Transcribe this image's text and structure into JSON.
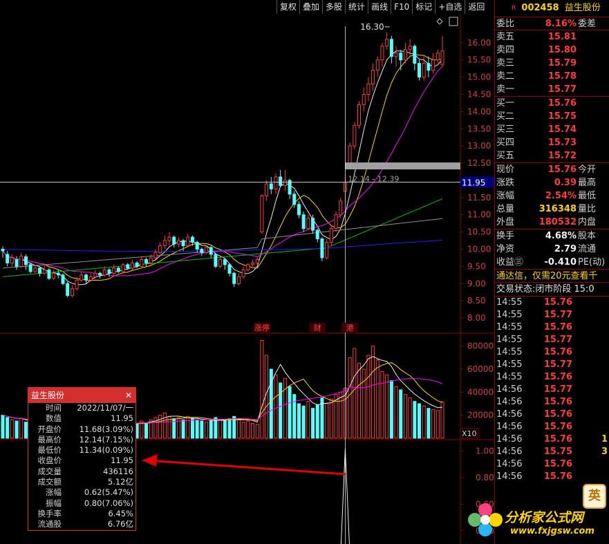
{
  "toolbar": [
    "复权",
    "叠加",
    "多股",
    "统计",
    "画线",
    "F10",
    "标记",
    "+自选",
    "返回"
  ],
  "stock": {
    "flag": "R",
    "code": "002458",
    "name": "益生股份"
  },
  "weibi": {
    "label": "委比",
    "value": "8.16%",
    "label2": "委差"
  },
  "sell": [
    {
      "label": "卖五",
      "price": "15.81"
    },
    {
      "label": "卖四",
      "price": "15.80"
    },
    {
      "label": "卖三",
      "price": "15.79"
    },
    {
      "label": "卖二",
      "price": "15.78"
    },
    {
      "label": "卖一",
      "price": "15.77"
    }
  ],
  "buy": [
    {
      "label": "买一",
      "price": "15.76"
    },
    {
      "label": "买二",
      "price": "15.75"
    },
    {
      "label": "买三",
      "price": "15.74"
    },
    {
      "label": "买四",
      "price": "15.73"
    },
    {
      "label": "买五",
      "price": "15.72"
    }
  ],
  "quote": [
    {
      "label": "现价",
      "value": "15.76",
      "label2": "今开",
      "color": "red"
    },
    {
      "label": "涨跌",
      "value": "0.39",
      "label2": "最高",
      "color": "red"
    },
    {
      "label": "涨幅",
      "value": "2.54%",
      "label2": "最低",
      "color": "red"
    },
    {
      "label": "总量",
      "value": "316348",
      "label2": "量比",
      "color": "yel"
    },
    {
      "label": "外盘",
      "value": "180532",
      "label2": "内盘",
      "color": "red"
    }
  ],
  "fund": [
    {
      "label": "换手",
      "value": "4.68%",
      "label2": "股本"
    },
    {
      "label": "净资",
      "value": "2.79",
      "label2": "流通"
    },
    {
      "label": "收益㊂",
      "value": "-0.410",
      "label2": "PE(动)"
    }
  ],
  "notice": "通达信，仅需20元查看千",
  "trade_state": "交易状态:闭市阶段 15:0",
  "ticks": [
    {
      "time": "14:55",
      "price": "15.76",
      "vol": ""
    },
    {
      "time": "14:55",
      "price": "15.77",
      "vol": ""
    },
    {
      "time": "14:55",
      "price": "15.76",
      "vol": ""
    },
    {
      "time": "14:55",
      "price": "15.77",
      "vol": ""
    },
    {
      "time": "14:55",
      "price": "15.76",
      "vol": ""
    },
    {
      "time": "14:55",
      "price": "15.77",
      "vol": ""
    },
    {
      "time": "14:55",
      "price": "15.76",
      "vol": ""
    },
    {
      "time": "14:56",
      "price": "15.77",
      "vol": ""
    },
    {
      "time": "14:56",
      "price": "15.76",
      "vol": ""
    },
    {
      "time": "14:56",
      "price": "15.76",
      "vol": ""
    },
    {
      "time": "14:56",
      "price": "15.76",
      "vol": ""
    },
    {
      "time": "14:56",
      "price": "15.76",
      "vol": "1"
    },
    {
      "time": "14:56",
      "price": "15.75",
      "vol": "3"
    },
    {
      "time": "14:56",
      "price": "15.76",
      "vol": ""
    },
    {
      "time": "14:56",
      "price": "15.76",
      "vol": ""
    }
  ],
  "info": {
    "title": "益生股份",
    "close_icon": "close-icon",
    "rows": [
      {
        "k": "时间",
        "v": "2022/11/07/一",
        "c": "wht"
      },
      {
        "k": "数值",
        "v": "11.95",
        "c": "wht"
      },
      {
        "k": "开盘价",
        "v": "11.68(3.09%)",
        "c": "red"
      },
      {
        "k": "最高价",
        "v": "12.14(7.15%)",
        "c": "red"
      },
      {
        "k": "最低价",
        "v": "11.34(0.09%)",
        "c": "red"
      },
      {
        "k": "收盘价",
        "v": "11.95",
        "c": "red"
      },
      {
        "k": "成交量",
        "v": "436116",
        "c": "yel"
      },
      {
        "k": "成交额",
        "v": "5.12亿",
        "c": "wht"
      },
      {
        "k": "涨幅",
        "v": "0.62(5.47%)",
        "c": "red"
      },
      {
        "k": "振幅",
        "v": "0.80(7.06%)",
        "c": "wht"
      },
      {
        "k": "换手率",
        "v": "6.45%",
        "c": "wht"
      },
      {
        "k": "流通股",
        "v": "6.76亿",
        "c": "wht"
      }
    ]
  },
  "chart_data": {
    "type": "candlestick",
    "price_axis": [
      "16.00",
      "15.50",
      "15.00",
      "14.50",
      "14.00",
      "13.50",
      "13.00",
      "12.50",
      "12.00",
      "11.50",
      "11.00",
      "10.50",
      "10.00",
      "9.50",
      "9.00",
      "8.50",
      "8.00"
    ],
    "price_range": [
      7.8,
      16.8
    ],
    "volume_axis": [
      "80000",
      "60000",
      "40000",
      "20000"
    ],
    "volume_unit": "X10",
    "volume_range": [
      0,
      90000
    ],
    "indicator_axis": [
      "1.00",
      "0.80",
      "0.60",
      "0.40"
    ],
    "indicator_range": [
      0.3,
      1.08
    ],
    "crosshair_value": "11.95",
    "high_label": "16.30",
    "gap_label": "12.14 - 12.39",
    "events": [
      {
        "text": "涨停",
        "index": 56
      },
      {
        "text": "财",
        "index": 68
      },
      {
        "text": "港",
        "index": 75
      }
    ],
    "selected_index": 74,
    "candles": [
      [
        10.0,
        9.95,
        10.08,
        9.75
      ],
      [
        9.85,
        9.6,
        9.95,
        9.5
      ],
      [
        9.6,
        9.75,
        9.85,
        9.5
      ],
      [
        9.7,
        9.5,
        9.8,
        9.4
      ],
      [
        9.5,
        9.8,
        9.9,
        9.45
      ],
      [
        9.78,
        9.55,
        9.85,
        9.4
      ],
      [
        9.55,
        9.35,
        9.6,
        9.3
      ],
      [
        9.35,
        9.45,
        9.55,
        9.3
      ],
      [
        9.45,
        9.3,
        9.5,
        9.2
      ],
      [
        9.3,
        9.4,
        9.55,
        9.25
      ],
      [
        9.4,
        9.15,
        9.45,
        9.1
      ],
      [
        9.15,
        9.3,
        9.4,
        9.1
      ],
      [
        9.3,
        9.25,
        9.4,
        9.15
      ],
      [
        9.25,
        9.0,
        9.3,
        8.95
      ],
      [
        9.0,
        8.65,
        9.05,
        8.6
      ],
      [
        8.65,
        8.85,
        8.95,
        8.6
      ],
      [
        8.85,
        9.1,
        9.2,
        8.8
      ],
      [
        9.1,
        9.25,
        9.35,
        9.05
      ],
      [
        9.25,
        9.1,
        9.3,
        9.0
      ],
      [
        9.1,
        9.2,
        9.3,
        9.05
      ],
      [
        9.2,
        9.3,
        9.4,
        9.15
      ],
      [
        9.3,
        9.25,
        9.35,
        9.15
      ],
      [
        9.25,
        9.4,
        9.5,
        9.2
      ],
      [
        9.4,
        9.3,
        9.45,
        9.2
      ],
      [
        9.3,
        9.45,
        9.55,
        9.25
      ],
      [
        9.45,
        9.35,
        9.5,
        9.3
      ],
      [
        9.35,
        9.55,
        9.6,
        9.3
      ],
      [
        9.55,
        9.45,
        9.6,
        9.4
      ],
      [
        9.45,
        9.6,
        9.7,
        9.4
      ],
      [
        9.6,
        9.5,
        9.65,
        9.45
      ],
      [
        9.5,
        9.7,
        9.8,
        9.45
      ],
      [
        9.7,
        9.6,
        9.75,
        9.5
      ],
      [
        9.6,
        9.75,
        9.85,
        9.55
      ],
      [
        9.75,
        9.9,
        10.0,
        9.7
      ],
      [
        9.9,
        10.1,
        10.2,
        9.85
      ],
      [
        10.1,
        10.25,
        10.4,
        10.0
      ],
      [
        10.25,
        10.35,
        10.5,
        10.1
      ],
      [
        10.35,
        10.15,
        10.4,
        10.05
      ],
      [
        10.15,
        10.25,
        10.35,
        10.05
      ],
      [
        10.25,
        10.1,
        10.3,
        9.95
      ],
      [
        10.1,
        10.35,
        10.45,
        10.05
      ],
      [
        10.35,
        10.2,
        10.4,
        10.1
      ],
      [
        10.2,
        10.0,
        10.25,
        9.9
      ],
      [
        10.0,
        9.9,
        10.05,
        9.8
      ],
      [
        9.9,
        10.05,
        10.1,
        9.85
      ],
      [
        10.05,
        9.85,
        10.1,
        9.75
      ],
      [
        9.85,
        9.5,
        9.9,
        9.45
      ],
      [
        9.5,
        9.7,
        9.8,
        9.45
      ],
      [
        9.7,
        9.55,
        9.75,
        9.4
      ],
      [
        9.55,
        9.3,
        9.6,
        9.2
      ],
      [
        9.3,
        9.0,
        9.35,
        8.9
      ],
      [
        9.0,
        9.2,
        9.3,
        8.95
      ],
      [
        9.2,
        9.4,
        9.5,
        9.15
      ],
      [
        9.4,
        9.55,
        9.6,
        9.35
      ],
      [
        9.55,
        9.6,
        9.7,
        9.5
      ],
      [
        9.6,
        9.7,
        9.8,
        9.55
      ],
      [
        10.5,
        11.55,
        11.6,
        10.45
      ],
      [
        11.55,
        11.9,
        12.0,
        11.4
      ],
      [
        11.9,
        11.75,
        12.1,
        11.6
      ],
      [
        11.75,
        12.1,
        12.2,
        11.6
      ],
      [
        12.1,
        11.85,
        12.3,
        11.8
      ],
      [
        11.85,
        12.0,
        12.3,
        11.7
      ],
      [
        12.0,
        11.6,
        12.05,
        11.45
      ],
      [
        11.6,
        11.3,
        11.7,
        11.2
      ],
      [
        11.3,
        11.0,
        11.4,
        10.9
      ],
      [
        11.0,
        10.6,
        11.1,
        10.5
      ],
      [
        10.6,
        10.9,
        11.0,
        10.55
      ],
      [
        10.9,
        10.55,
        11.0,
        10.45
      ],
      [
        10.55,
        10.3,
        10.6,
        10.2
      ],
      [
        10.3,
        9.75,
        10.35,
        9.65
      ],
      [
        9.75,
        10.2,
        10.3,
        9.7
      ],
      [
        10.2,
        10.6,
        10.7,
        10.1
      ],
      [
        10.6,
        11.0,
        11.1,
        10.5
      ],
      [
        11.0,
        11.4,
        11.5,
        10.9
      ],
      [
        11.68,
        11.95,
        12.14,
        11.34
      ],
      [
        12.4,
        13.0,
        13.1,
        12.35
      ],
      [
        13.0,
        13.6,
        13.7,
        12.9
      ],
      [
        13.6,
        14.2,
        14.3,
        13.5
      ],
      [
        14.2,
        14.5,
        14.7,
        14.0
      ],
      [
        14.5,
        14.8,
        15.0,
        14.3
      ],
      [
        14.8,
        15.2,
        15.4,
        14.6
      ],
      [
        15.2,
        15.5,
        15.6,
        15.0
      ],
      [
        15.5,
        15.9,
        16.0,
        15.3
      ],
      [
        15.9,
        16.1,
        16.3,
        15.8
      ],
      [
        16.1,
        15.6,
        16.2,
        15.4
      ],
      [
        15.6,
        15.7,
        15.9,
        15.3
      ],
      [
        15.7,
        15.5,
        15.8,
        15.2
      ],
      [
        15.5,
        15.8,
        16.0,
        15.4
      ],
      [
        15.8,
        15.9,
        16.1,
        15.6
      ],
      [
        15.9,
        15.4,
        15.95,
        15.2
      ],
      [
        15.4,
        15.0,
        15.5,
        14.9
      ],
      [
        15.0,
        15.4,
        15.6,
        14.9
      ],
      [
        15.4,
        15.2,
        15.6,
        15.0
      ],
      [
        15.2,
        15.5,
        15.7,
        15.1
      ],
      [
        15.5,
        15.7,
        15.8,
        15.4
      ],
      [
        15.37,
        15.76,
        16.2,
        15.3
      ]
    ],
    "volumes": [
      20000,
      18000,
      16000,
      15000,
      17000,
      14000,
      13000,
      12000,
      14000,
      12000,
      11000,
      13000,
      12000,
      15000,
      18000,
      16000,
      14000,
      13000,
      12000,
      13000,
      12000,
      11000,
      13000,
      12000,
      14000,
      12000,
      13000,
      12000,
      14000,
      13000,
      15000,
      13000,
      16000,
      18000,
      20000,
      22000,
      19000,
      17000,
      18000,
      16000,
      19000,
      17000,
      16000,
      15000,
      14000,
      15000,
      18000,
      16000,
      15000,
      17000,
      19000,
      16000,
      14000,
      15000,
      13000,
      12000,
      85000,
      72000,
      60000,
      55000,
      48000,
      52000,
      45000,
      38000,
      30000,
      28000,
      32000,
      26000,
      29000,
      35000,
      30000,
      34000,
      38000,
      40000,
      43611,
      70000,
      78000,
      65000,
      60000,
      72000,
      80000,
      68000,
      58000,
      55000,
      50000,
      45000,
      42000,
      38000,
      35000,
      32000,
      30000,
      28000,
      26000,
      25000,
      24000,
      31634
    ],
    "ma": [
      {
        "name": "MA5",
        "color": "#f0f0f0"
      },
      {
        "name": "MA10",
        "color": "#ffd400"
      },
      {
        "name": "MA20",
        "color": "#ff00ff"
      },
      {
        "name": "MA60",
        "color": "#00c000"
      },
      {
        "name": "MA120",
        "color": "#909090"
      },
      {
        "name": "MA250",
        "color": "#2020ff"
      }
    ]
  }
}
